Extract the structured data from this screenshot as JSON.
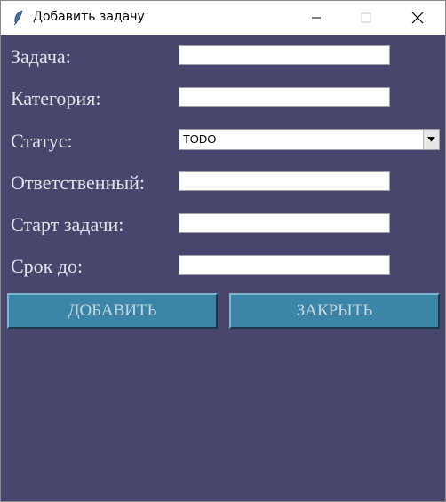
{
  "window": {
    "title": "Добавить задачу",
    "app_icon": "feather-icon",
    "controls": [
      "minimize-icon",
      "maximize-icon",
      "close-icon"
    ]
  },
  "form": {
    "task_label": "Задача:",
    "task_value": "",
    "category_label": "Категория:",
    "category_value": "",
    "status_label": "Статус:",
    "status_value": "TODO",
    "assignee_label": "Ответственный:",
    "assignee_value": "",
    "start_label": "Старт задачи:",
    "start_value": "",
    "due_label": "Срок до:",
    "due_value": ""
  },
  "buttons": {
    "add_label": "ДОБАВИТЬ",
    "close_label": "ЗАКРЫТЬ"
  },
  "colors": {
    "background": "#48466d",
    "button": "#3b85a8",
    "label_text": "#e3e3ea"
  }
}
